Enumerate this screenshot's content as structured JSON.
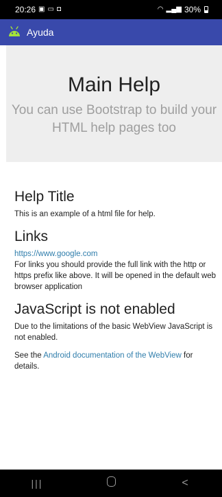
{
  "status_bar": {
    "time": "20:26",
    "battery": "30%",
    "left_icons": [
      "image-icon",
      "cast-icon",
      "notification-icon"
    ],
    "right_icons": [
      "wifi-icon",
      "signal-icon",
      "battery-icon"
    ]
  },
  "app_bar": {
    "title": "Ayuda",
    "icon": "android-icon",
    "color": "#3949ab"
  },
  "jumbotron": {
    "title": "Main Help",
    "lead": "You can use Bootstrap to build your HTML help pages too"
  },
  "content": {
    "help_title": "Help Title",
    "help_text": "This is an example of a html file for help.",
    "links_title": "Links",
    "link_url": "https://www.google.com",
    "links_text": "For links you should provide the full link with the http or https prefix like above. It will be opened in the default web browser application",
    "js_title": "JavaScript is not enabled",
    "js_text": "Due to the limitations of the basic WebView JavaScript is not enabled.",
    "see_prefix": "See the ",
    "see_link": "Android documentation of the WebView",
    "see_suffix": " for details.",
    "link_color": "#2f7dab"
  },
  "nav_bar": {
    "recents": "|||",
    "home": "",
    "back": "<"
  }
}
